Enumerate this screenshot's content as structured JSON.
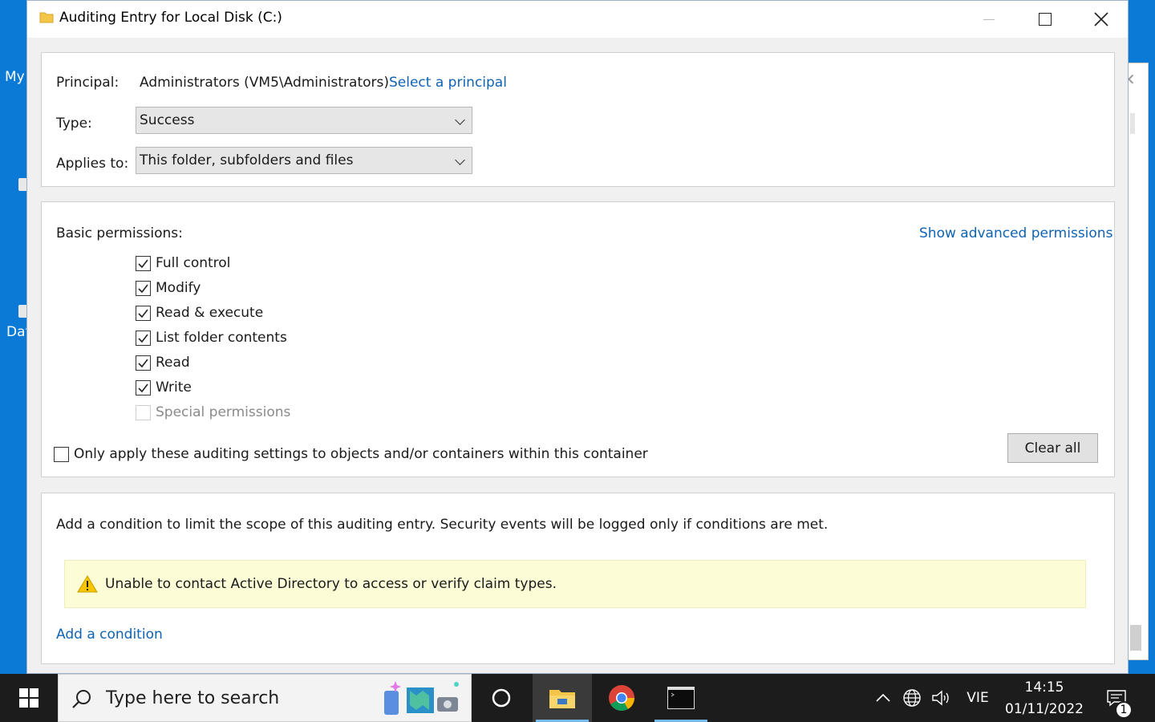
{
  "window": {
    "title": "Auditing Entry for Local Disk (C:)"
  },
  "principal": {
    "label": "Principal:",
    "value": "Administrators (VM5\\Administrators)",
    "select_link": "Select a principal"
  },
  "type": {
    "label": "Type:",
    "value": "Success"
  },
  "applies_to": {
    "label": "Applies to:",
    "value": "This folder, subfolders and files"
  },
  "permissions": {
    "label": "Basic permissions:",
    "advanced_link": "Show advanced permissions",
    "items": [
      {
        "label": "Full control",
        "checked": true,
        "enabled": true
      },
      {
        "label": "Modify",
        "checked": true,
        "enabled": true
      },
      {
        "label": "Read & execute",
        "checked": true,
        "enabled": true
      },
      {
        "label": "List folder contents",
        "checked": true,
        "enabled": true
      },
      {
        "label": "Read",
        "checked": true,
        "enabled": true
      },
      {
        "label": "Write",
        "checked": true,
        "enabled": true
      },
      {
        "label": "Special permissions",
        "checked": false,
        "enabled": false
      }
    ],
    "only_apply_label": "Only apply these auditing settings to objects and/or containers within this container",
    "only_apply_checked": false,
    "clear_all_label": "Clear all"
  },
  "conditions": {
    "description": "Add a condition to limit the scope of this auditing entry. Security events will be logged only if conditions are met.",
    "warning": "Unable to contact Active Directory to access or verify claim types.",
    "add_link": "Add a condition"
  },
  "desktop": {
    "fragments": [
      "My",
      "Dat"
    ]
  },
  "taskbar": {
    "search_placeholder": "Type here to search",
    "language": "VIE",
    "time": "14:15",
    "date": "01/11/2022",
    "notification_count": "1"
  },
  "colors": {
    "link": "#0e63b5",
    "desktop": "#0b79d6",
    "taskbar": "#1c1c1c",
    "warning_bg": "#fcfcd6"
  }
}
